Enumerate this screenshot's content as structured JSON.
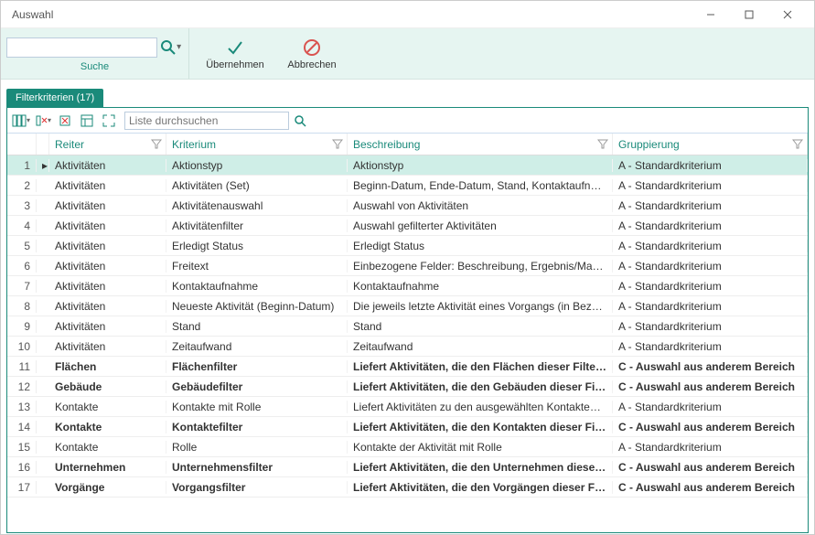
{
  "window": {
    "title": "Auswahl"
  },
  "toolbar": {
    "search_label": "Suche",
    "search_value": "",
    "accept_label": "Übernehmen",
    "cancel_label": "Abbrechen"
  },
  "tab": {
    "label": "Filterkriterien (17)"
  },
  "grid_toolbar": {
    "search_placeholder": "Liste durchsuchen"
  },
  "columns": {
    "reiter": "Reiter",
    "kriterium": "Kriterium",
    "beschreibung": "Beschreibung",
    "gruppierung": "Gruppierung"
  },
  "rows": [
    {
      "n": "1",
      "sel": true,
      "bold": false,
      "reiter": "Aktivitäten",
      "k": "Aktionstyp",
      "b": "Aktionstyp",
      "g": "A - Standardkriterium"
    },
    {
      "n": "2",
      "sel": false,
      "bold": false,
      "reiter": "Aktivitäten",
      "k": "Aktivitäten (Set)",
      "b": "Beginn-Datum, Ende-Datum, Stand, Kontaktaufnahme,...",
      "g": "A - Standardkriterium"
    },
    {
      "n": "3",
      "sel": false,
      "bold": false,
      "reiter": "Aktivitäten",
      "k": "Aktivitätenauswahl",
      "b": "Auswahl von Aktivitäten",
      "g": "A - Standardkriterium"
    },
    {
      "n": "4",
      "sel": false,
      "bold": false,
      "reiter": "Aktivitäten",
      "k": "Aktivitätenfilter",
      "b": "Auswahl gefilterter Aktivitäten",
      "g": "A - Standardkriterium"
    },
    {
      "n": "5",
      "sel": false,
      "bold": false,
      "reiter": "Aktivitäten",
      "k": "Erledigt Status",
      "b": "Erledigt Status",
      "g": "A - Standardkriterium"
    },
    {
      "n": "6",
      "sel": false,
      "bold": false,
      "reiter": "Aktivitäten",
      "k": "Freitext",
      "b": "Einbezogene Felder: Beschreibung, Ergebnis/Maßnah...",
      "g": "A - Standardkriterium"
    },
    {
      "n": "7",
      "sel": false,
      "bold": false,
      "reiter": "Aktivitäten",
      "k": "Kontaktaufnahme",
      "b": "Kontaktaufnahme",
      "g": "A - Standardkriterium"
    },
    {
      "n": "8",
      "sel": false,
      "bold": false,
      "reiter": "Aktivitäten",
      "k": "Neueste Aktivität (Beginn-Datum)",
      "b": "Die jeweils letzte Aktivität eines Vorgangs (in Bezug au...",
      "g": "A - Standardkriterium"
    },
    {
      "n": "9",
      "sel": false,
      "bold": false,
      "reiter": "Aktivitäten",
      "k": "Stand",
      "b": "Stand",
      "g": "A - Standardkriterium"
    },
    {
      "n": "10",
      "sel": false,
      "bold": false,
      "reiter": "Aktivitäten",
      "k": "Zeitaufwand",
      "b": "Zeitaufwand",
      "g": "A - Standardkriterium"
    },
    {
      "n": "11",
      "sel": false,
      "bold": true,
      "reiter": "Flächen",
      "k": "Flächenfilter",
      "b": "Liefert Aktivitäten, die den Flächen dieser Filter zuge...",
      "g": "C - Auswahl aus anderem Bereich"
    },
    {
      "n": "12",
      "sel": false,
      "bold": true,
      "reiter": "Gebäude",
      "k": "Gebäudefilter",
      "b": "Liefert Aktivitäten, die den Gebäuden dieser Filter zu...",
      "g": "C - Auswahl aus anderem Bereich"
    },
    {
      "n": "13",
      "sel": false,
      "bold": false,
      "reiter": "Kontakte",
      "k": "Kontakte mit Rolle",
      "b": "Liefert Aktivitäten zu den ausgewählten Kontakten (mit...",
      "g": "A - Standardkriterium"
    },
    {
      "n": "14",
      "sel": false,
      "bold": true,
      "reiter": "Kontakte",
      "k": "Kontaktefilter",
      "b": "Liefert Aktivitäten, die den Kontakten dieser Filter zu...",
      "g": "C - Auswahl aus anderem Bereich"
    },
    {
      "n": "15",
      "sel": false,
      "bold": false,
      "reiter": "Kontakte",
      "k": "Rolle",
      "b": "Kontakte der Aktivität mit Rolle",
      "g": "A - Standardkriterium"
    },
    {
      "n": "16",
      "sel": false,
      "bold": true,
      "reiter": "Unternehmen",
      "k": "Unternehmensfilter",
      "b": "Liefert Aktivitäten, die den Unternehmen dieser Filter...",
      "g": "C - Auswahl aus anderem Bereich"
    },
    {
      "n": "17",
      "sel": false,
      "bold": true,
      "reiter": "Vorgänge",
      "k": "Vorgangsfilter",
      "b": "Liefert Aktivitäten, die den Vorgängen dieser Filter z...",
      "g": "C - Auswahl aus anderem Bereich"
    }
  ]
}
